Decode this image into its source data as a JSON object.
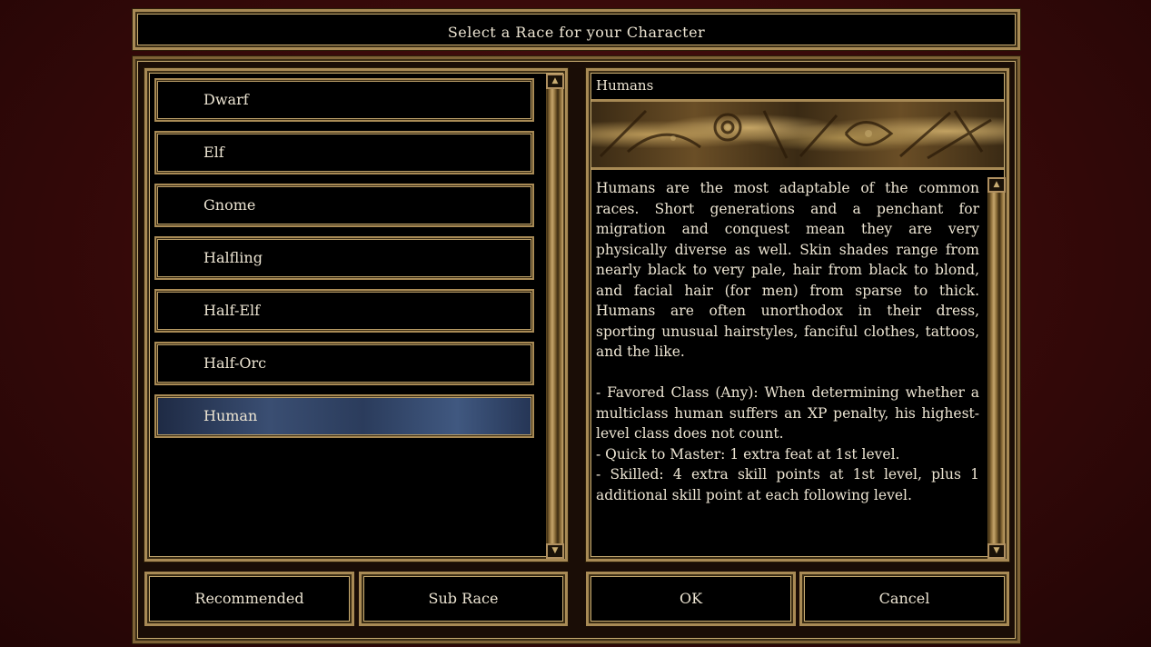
{
  "title": "Select a Race for your Character",
  "races": [
    {
      "label": "Dwarf",
      "selected": false
    },
    {
      "label": "Elf",
      "selected": false
    },
    {
      "label": "Gnome",
      "selected": false
    },
    {
      "label": "Halfling",
      "selected": false
    },
    {
      "label": "Half-Elf",
      "selected": false
    },
    {
      "label": "Half-Orc",
      "selected": false
    },
    {
      "label": "Human",
      "selected": true
    }
  ],
  "info": {
    "header": "Humans",
    "banner_icon": "equipment-banner-image",
    "description": "Humans are the most adaptable of the common races. Short generations and a penchant for migration and conquest mean they are very physically diverse as well. Skin shades range from nearly black to very pale, hair from black to blond, and facial hair (for men) from sparse to thick. Humans are often unorthodox in their dress, sporting unusual hairstyles, fanciful clothes, tattoos, and the like.\n\n- Favored Class (Any): When determining whether a multiclass human suffers an XP penalty, his highest-level class does not count.\n- Quick to Master: 1 extra feat at 1st level.\n- Skilled: 4 extra skill points at 1st level, plus 1 additional skill point at each following level."
  },
  "buttons": {
    "recommended": "Recommended",
    "sub_race": "Sub Race",
    "ok": "OK",
    "cancel": "Cancel"
  },
  "colors": {
    "gold_border": "#a88a55",
    "selected_blue": "#3a4e72",
    "background_red": "#3a0a0a"
  }
}
